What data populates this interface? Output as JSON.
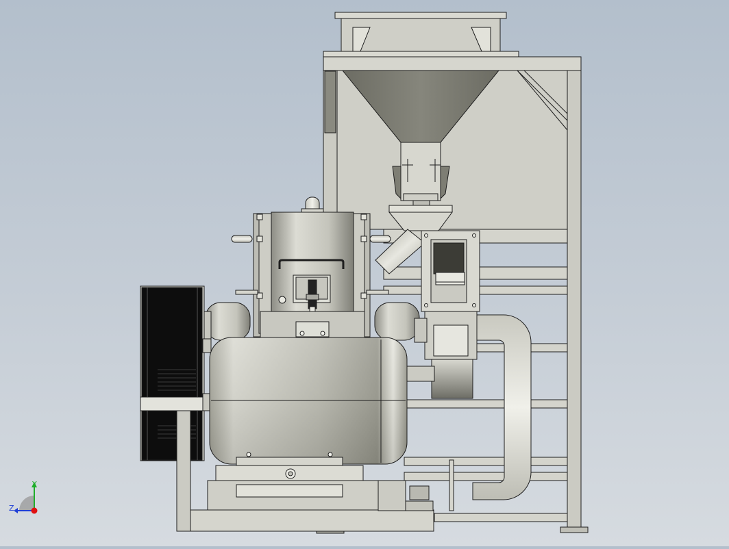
{
  "viewport": {
    "background_top": "#b3bfcc",
    "background_bottom": "#d6dbe0"
  },
  "colors": {
    "metal_light": "#e6e6df",
    "metal_mid": "#c9c9bf",
    "metal_dark": "#7d7d74",
    "hopper_dark": "#74746a",
    "outline": "#1e1e1e",
    "belt_black": "#0d0d0d"
  },
  "triad": {
    "y_label": "Y",
    "z_label": "Z",
    "y_axis_color": "#1fae2a",
    "z_axis_color": "#1f3fd6",
    "x_axis_color": "#e01010"
  }
}
